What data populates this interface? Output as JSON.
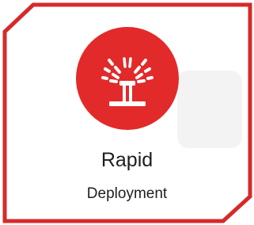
{
  "tile": {
    "title": "Rapid",
    "subtitle": "Deployment",
    "icon": "sprinkler-icon",
    "accent_color": "#e22a2a"
  }
}
